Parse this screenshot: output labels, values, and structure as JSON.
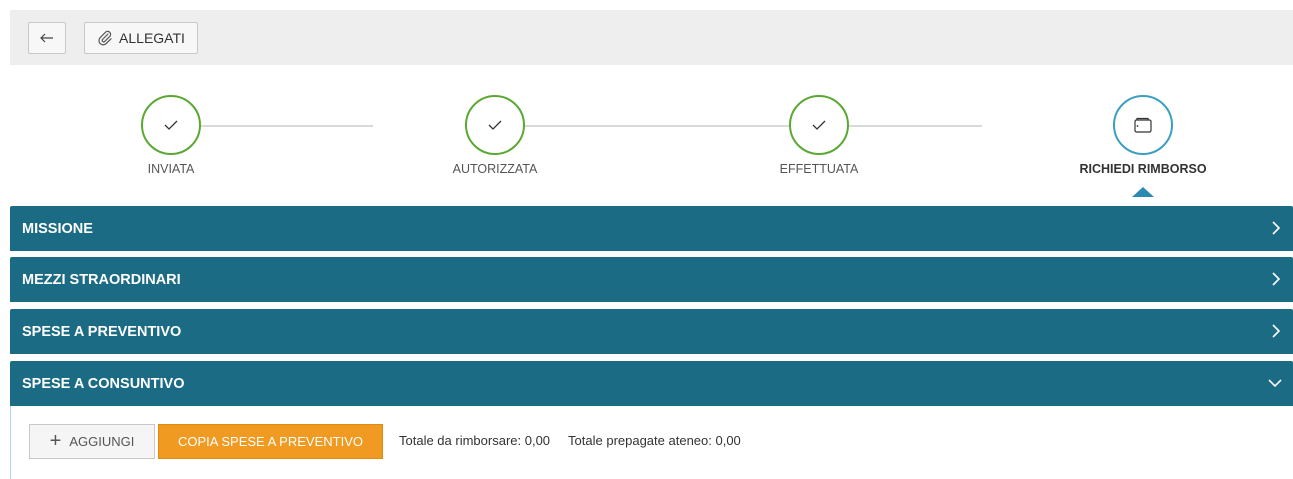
{
  "toolbar": {
    "back_icon": "arrow-left-icon",
    "attachments_icon": "paperclip-icon",
    "attachments_label": "ALLEGATI"
  },
  "steps": [
    {
      "label": "INVIATA",
      "status": "done",
      "icon": "check-icon"
    },
    {
      "label": "AUTORIZZATA",
      "status": "done",
      "icon": "check-icon"
    },
    {
      "label": "EFFETTUATA",
      "status": "done",
      "icon": "check-icon"
    },
    {
      "label": "RICHIEDI RIMBORSO",
      "status": "current",
      "icon": "wallet-icon"
    }
  ],
  "sections": [
    {
      "label": "MISSIONE",
      "expanded": false
    },
    {
      "label": "MEZZI STRAORDINARI",
      "expanded": false
    },
    {
      "label": "SPESE A PREVENTIVO",
      "expanded": false
    },
    {
      "label": "SPESE A CONSUNTIVO",
      "expanded": true
    }
  ],
  "consuntivo": {
    "add_label": "AGGIUNGI",
    "copy_label": "COPIA SPESE A PREVENTIVO",
    "total_refund": "Totale da rimborsare: 0,00",
    "total_prepaid": "Totale prepagate ateneo: 0,00"
  },
  "colors": {
    "section_bg": "#1b6b84",
    "done": "#5aa832",
    "current": "#3a9fc0",
    "accent_button": "#f09a22"
  }
}
